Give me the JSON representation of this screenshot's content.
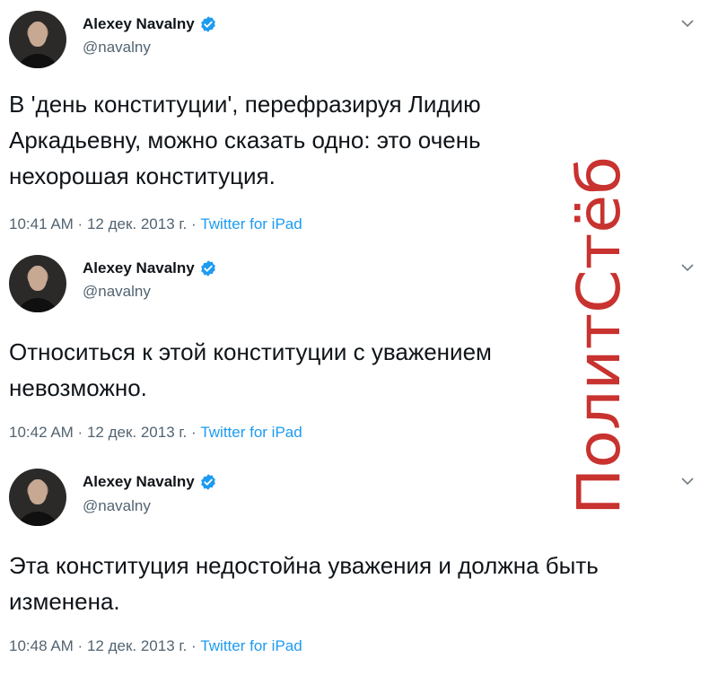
{
  "author": {
    "name": "Alexey Navalny",
    "handle": "@navalny"
  },
  "tweets": [
    {
      "text": "В 'день конституции', перефразируя Лидию Аркадьевну, можно сказать одно: это очень нехорошая конституция.",
      "time": "10:41 AM",
      "date": "12 дек. 2013 г.",
      "source": "Twitter for iPad"
    },
    {
      "text": "Относиться к этой конституции с уважением невозможно.",
      "time": "10:42 AM",
      "date": "12 дек. 2013 г.",
      "source": "Twitter for iPad"
    },
    {
      "text": "Эта конституция недостойна уважения и должна быть изменена.",
      "time": "10:48 AM",
      "date": "12 дек. 2013 г.",
      "source": "Twitter for iPad"
    }
  ],
  "separator": " · ",
  "watermark": {
    "text": "ПолитСтёб",
    "color": "#c8322f"
  },
  "icons": {
    "verified": "verified-badge-icon",
    "more": "chevron-down-icon"
  },
  "colors": {
    "text": "#0f1419",
    "secondary": "#536471",
    "link": "#1d9bf0",
    "verified": "#1d9bf0"
  }
}
